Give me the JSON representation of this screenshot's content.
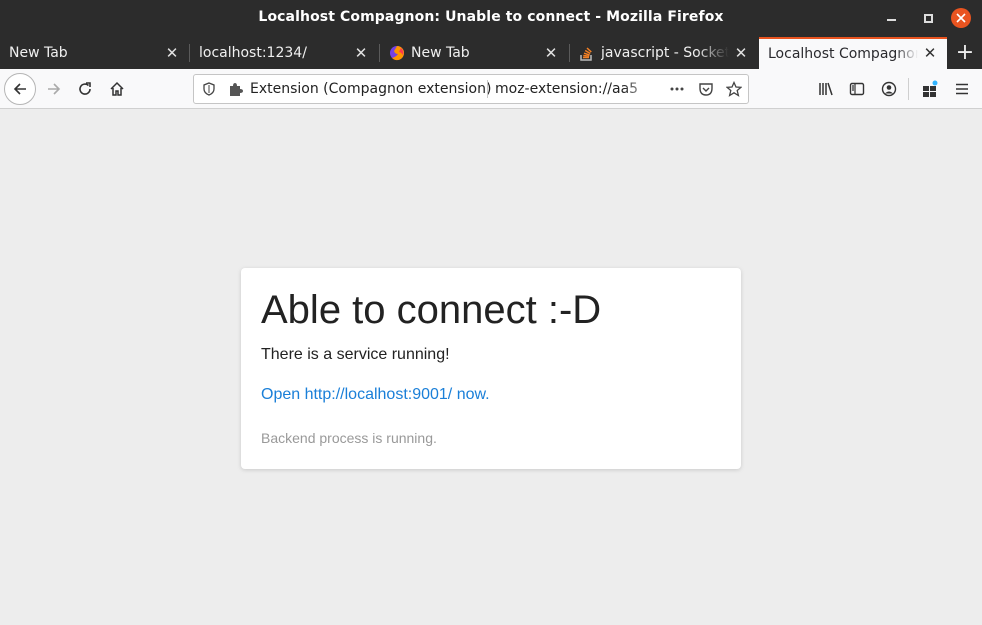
{
  "window": {
    "title": "Localhost Compagnon: Unable to connect - Mozilla Firefox",
    "accent": "#e95420"
  },
  "tabs": [
    {
      "label": "New Tab"
    },
    {
      "label": "localhost:1234/"
    },
    {
      "label": "New Tab",
      "icon": "firefox-icon"
    },
    {
      "label": "javascript - Socket.i",
      "icon": "stackoverflow-icon"
    },
    {
      "label": "Localhost Compagnon",
      "active": true
    }
  ],
  "navbar": {
    "extension_label": "Extension (Compagnon extension)",
    "url": "moz-extension://aa5"
  },
  "content": {
    "heading": "Able to connect :-D",
    "status": "There is a service running!",
    "link": "Open http://localhost:9001/ now.",
    "footer": "Backend process is running."
  }
}
